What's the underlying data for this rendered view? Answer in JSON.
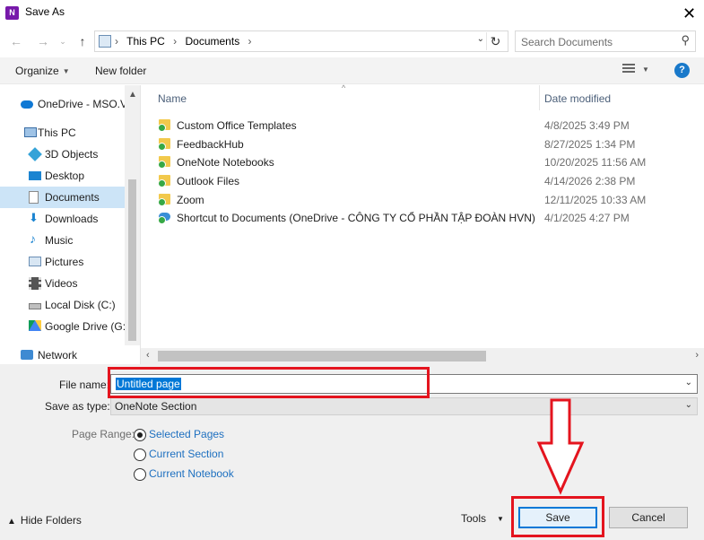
{
  "window": {
    "title": "Save As",
    "app_icon_letter": "N"
  },
  "nav": {
    "breadcrumbs": [
      "This PC",
      "Documents"
    ],
    "search_placeholder": "Search Documents"
  },
  "toolbar": {
    "organize": "Organize",
    "new_folder": "New folder",
    "help": "?"
  },
  "sidebar": {
    "items": [
      {
        "label": "OneDrive - MSO.VN",
        "icon": "onedrive-icon"
      },
      {
        "label": "This PC",
        "icon": "this-pc-icon"
      },
      {
        "label": "3D Objects",
        "icon": "3d-objects-icon"
      },
      {
        "label": "Desktop",
        "icon": "desktop-icon"
      },
      {
        "label": "Documents",
        "icon": "documents-icon",
        "selected": true
      },
      {
        "label": "Downloads",
        "icon": "downloads-icon"
      },
      {
        "label": "Music",
        "icon": "music-icon"
      },
      {
        "label": "Pictures",
        "icon": "pictures-icon"
      },
      {
        "label": "Videos",
        "icon": "videos-icon"
      },
      {
        "label": "Local Disk (C:)",
        "icon": "local-disk-icon"
      },
      {
        "label": "Google Drive (G:)",
        "icon": "google-drive-icon"
      },
      {
        "label": "Network",
        "icon": "network-icon"
      }
    ]
  },
  "filelist": {
    "columns": {
      "name": "Name",
      "date": "Date modified"
    },
    "rows": [
      {
        "name": "Custom Office Templates",
        "date": "4/8/2025 3:49 PM"
      },
      {
        "name": "FeedbackHub",
        "date": "8/27/2025 1:34 PM"
      },
      {
        "name": "OneNote Notebooks",
        "date": "10/20/2025 11:56 AM"
      },
      {
        "name": "Outlook Files",
        "date": "4/14/2026 2:38 PM"
      },
      {
        "name": "Zoom",
        "date": "12/11/2025 10:33 AM"
      },
      {
        "name": "Shortcut to Documents (OneDrive - CÔNG TY CỔ PHẦN TẬP ĐOÀN HVN)",
        "date": "4/1/2025 4:27 PM"
      }
    ]
  },
  "form": {
    "file_name_label": "File name:",
    "file_name_value": "Untitled page",
    "save_as_type_label": "Save as type:",
    "save_as_type_value": "OneNote Section",
    "page_range_label": "Page Range:",
    "page_range_options": [
      "Selected Pages",
      "Current Section",
      "Current Notebook"
    ],
    "page_range_selected": "Selected Pages"
  },
  "footer": {
    "hide_folders": "Hide Folders",
    "tools": "Tools",
    "save": "Save",
    "cancel": "Cancel"
  },
  "colors": {
    "annotation": "#e4141e",
    "accent": "#0078d7",
    "selection": "#cce4f7"
  }
}
